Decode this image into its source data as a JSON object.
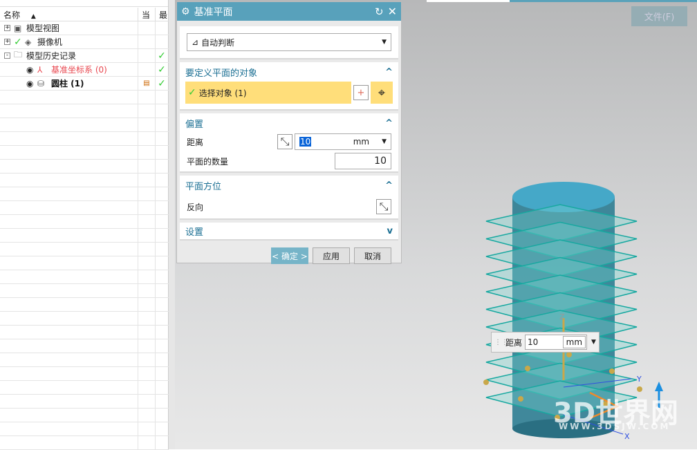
{
  "navigator": {
    "columns": [
      "名称",
      "当",
      "最"
    ],
    "rows": [
      {
        "label": "模型视图",
        "expander": "+",
        "check": false,
        "status": "",
        "latest": false,
        "color": "#222"
      },
      {
        "label": "摄像机",
        "expander": "+",
        "check": true,
        "status": "",
        "latest": false,
        "color": "#222"
      },
      {
        "label": "模型历史记录",
        "expander": "-",
        "check": false,
        "status": "",
        "latest": true,
        "color": "#222"
      },
      {
        "label": "基准坐标系 (0)",
        "expander": "",
        "check": false,
        "status": "",
        "latest": true,
        "color": "#e8474f"
      },
      {
        "label": "圆柱 (1)",
        "expander": "",
        "check": false,
        "status": "tree-icon",
        "latest": true,
        "color": "#111"
      }
    ]
  },
  "dialog": {
    "title": "基准平面",
    "type_value": "自动判断",
    "sections": {
      "objects": {
        "title": "要定义平面的对象",
        "select_label": "选择对象 (1)"
      },
      "offset": {
        "title": "偏置",
        "distance_label": "距离",
        "distance_value": "10",
        "unit": "mm",
        "count_label": "平面的数量",
        "count_value": "10"
      },
      "orientation": {
        "title": "平面方位",
        "reverse_label": "反向"
      },
      "settings": {
        "title": "设置"
      }
    },
    "ok": "< 确定 >",
    "apply": "应用",
    "cancel": "取消"
  },
  "toolbar": {
    "file_menu": "文件(F)"
  },
  "viewport": {
    "tip_label": "距离",
    "tip_value": "10",
    "tip_unit": "mm",
    "axes": [
      "X",
      "Y",
      "Z"
    ],
    "watermark": "3D世界网",
    "watermark_url": "WWW.3DSJW.COM"
  }
}
